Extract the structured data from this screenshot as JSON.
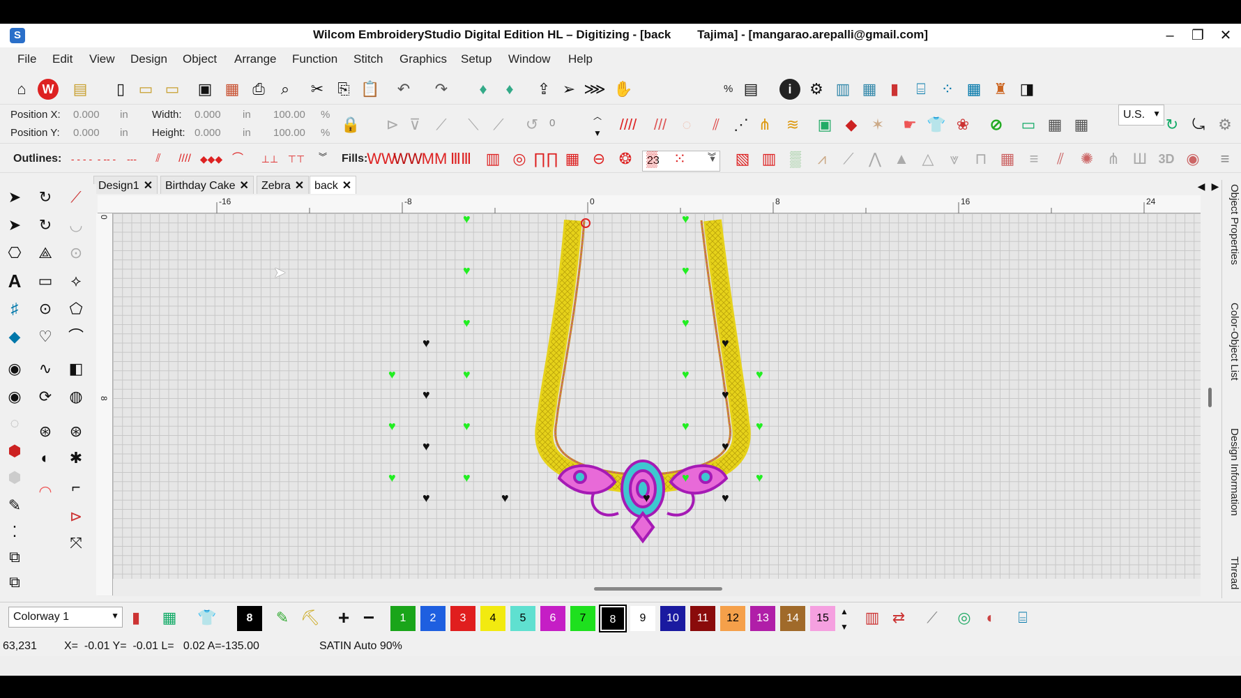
{
  "window": {
    "title": "Wilcom EmbroideryStudio Digital Edition HL – Digitizing - [back        Tajima] - [mangarao.arepalli@gmail.com]"
  },
  "menu": [
    "File",
    "Edit",
    "View",
    "Design",
    "Object",
    "Arrange",
    "Function",
    "Stitch",
    "Graphics",
    "Setup",
    "Window",
    "Help"
  ],
  "toolbar": {
    "zoom_value": "23",
    "zoom_unit": "%",
    "rotate_value": "0",
    "units": "U.S."
  },
  "position": {
    "x_label": "Position X:",
    "x_value": "0.000",
    "x_unit": "in",
    "y_label": "Position Y:",
    "y_value": "0.000",
    "y_unit": "in",
    "w_label": "Width:",
    "w_value": "0.000",
    "w_unit": "in",
    "w_pct": "100.00",
    "w_pct_unit": "%",
    "h_label": "Height:",
    "h_value": "0.000",
    "h_unit": "in",
    "h_pct": "100.00",
    "h_pct_unit": "%"
  },
  "outlines_label": "Outlines:",
  "fills_label": "Fills:",
  "fills_3d": "3D",
  "tabs": [
    {
      "label": "Design1",
      "close": "✕"
    },
    {
      "label": "Birthday Cake",
      "close": "✕"
    },
    {
      "label": "Zebra",
      "close": "✕"
    },
    {
      "label": "back",
      "close": "✕"
    }
  ],
  "ruler": {
    "h": [
      "-16",
      "-8",
      "0",
      "8",
      "16",
      "24"
    ],
    "v": [
      "0",
      "8"
    ]
  },
  "right_panel": [
    "Object Properties",
    "Color-Object List",
    "Design Information",
    "Thread"
  ],
  "colorway": {
    "value": "Colorway 1"
  },
  "current_color": "8",
  "swatches": [
    {
      "n": "1",
      "c": "#1aa51a"
    },
    {
      "n": "2",
      "c": "#1e5fe0"
    },
    {
      "n": "3",
      "c": "#e01e1e"
    },
    {
      "n": "4",
      "c": "#f2ea10"
    },
    {
      "n": "5",
      "c": "#5fe0d0"
    },
    {
      "n": "6",
      "c": "#c51ec5"
    },
    {
      "n": "7",
      "c": "#1ee01e"
    },
    {
      "n": "8",
      "c": "#000000"
    },
    {
      "n": "9",
      "c": "#ffffff"
    },
    {
      "n": "10",
      "c": "#1a1aa0"
    },
    {
      "n": "11",
      "c": "#8a0b0b"
    },
    {
      "n": "12",
      "c": "#f5a04a"
    },
    {
      "n": "13",
      "c": "#b01ea8"
    },
    {
      "n": "14",
      "c": "#a06a2a"
    },
    {
      "n": "15",
      "c": "#f5a0e0"
    }
  ],
  "status": {
    "coords": "63,231",
    "xy": "X=  -0.01 Y=  -0.01 L=   0.02 A=-135.00",
    "stitch": "SATIN Auto 90%"
  }
}
